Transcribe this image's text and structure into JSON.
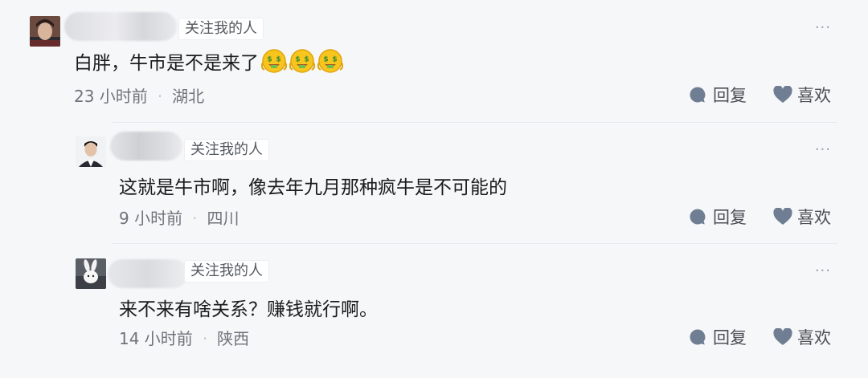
{
  "comments": [
    {
      "badge": "关注我的人",
      "text": "白胖，牛市是不是来了",
      "emojis": [
        "money-face-emoji",
        "money-face-emoji",
        "money-face-emoji"
      ],
      "time": "23 小时前",
      "separator": "·",
      "location": "湖北",
      "reply_label": "回复",
      "like_label": "喜欢",
      "more_label": "···"
    },
    {
      "badge": "关注我的人",
      "text": "这就是牛市啊，像去年九月那种疯牛是不可能的",
      "time": "9 小时前",
      "separator": "·",
      "location": "四川",
      "reply_label": "回复",
      "like_label": "喜欢",
      "more_label": "···"
    },
    {
      "badge": "关注我的人",
      "text": "来不来有啥关系？赚钱就行啊。",
      "time": "14 小时前",
      "separator": "·",
      "location": "陕西",
      "reply_label": "回复",
      "like_label": "喜欢",
      "more_label": "···"
    }
  ],
  "colors": {
    "background": "#f6f7f9",
    "icon": "#6f7e92",
    "meta_text": "#6f747a"
  },
  "icons": {
    "reply": "speech-bubble-icon",
    "like": "heart-icon",
    "more": "ellipsis-icon"
  }
}
